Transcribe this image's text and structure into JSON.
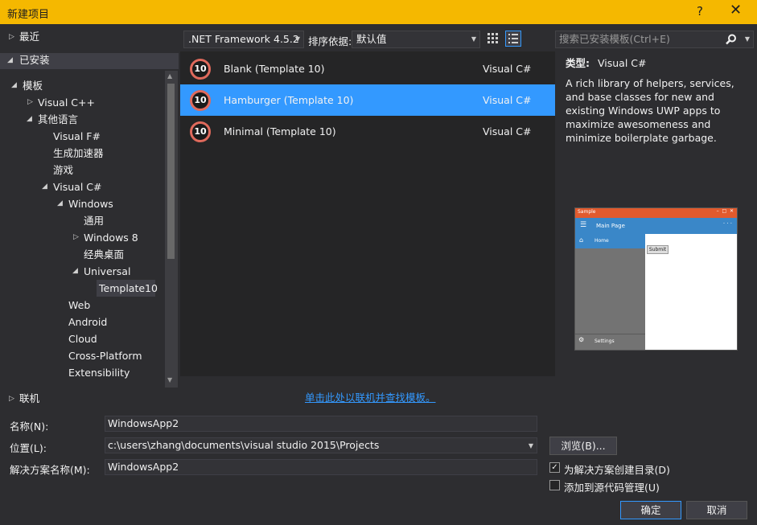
{
  "title": "新建项目",
  "title_help": "?",
  "title_close": "✕",
  "tree": {
    "recent": "最近",
    "installed": "已安装",
    "templates": "模板",
    "visual_cpp": "Visual C++",
    "other_languages": "其他语言",
    "visual_fsharp": "Visual F#",
    "generator": "生成加速器",
    "games": "游戏",
    "visual_csharp": "Visual C#",
    "windows": "Windows",
    "general": "通用",
    "windows8": "Windows 8",
    "classic_desktop": "经典桌面",
    "universal": "Universal",
    "template10": "Template10",
    "web": "Web",
    "android": "Android",
    "cloud": "Cloud",
    "cross_platform": "Cross-Platform",
    "extensibility": "Extensibility",
    "online": "联机"
  },
  "toolbar": {
    "framework": ".NET Framework 4.5.2",
    "sort_label": "排序依据:",
    "sort_value": "默认值"
  },
  "search": {
    "placeholder": "搜索已安装模板(Ctrl+E)"
  },
  "templates": [
    {
      "badge": "10",
      "name": "Blank (Template 10)",
      "lang": "Visual C#"
    },
    {
      "badge": "10",
      "name": "Hamburger (Template 10)",
      "lang": "Visual C#"
    },
    {
      "badge": "10",
      "name": "Minimal (Template 10)",
      "lang": "Visual C#"
    }
  ],
  "online_link": "单击此处以联机并查找模板。",
  "details": {
    "type_label": "类型:",
    "type_value": "Visual C#",
    "description": "A rich library of helpers, services, and base classes for new and existing Windows UWP apps to maximize awesomeness and minimize boilerplate garbage."
  },
  "preview": {
    "app_title": "Sample",
    "page_title": "Main Page",
    "nav_home": "Home",
    "nav_settings": "Settings",
    "button": "Submit"
  },
  "form": {
    "name_label": "名称(N):",
    "name_value": "WindowsApp2",
    "location_label": "位置(L):",
    "location_value": "c:\\users\\zhang\\documents\\visual studio 2015\\Projects",
    "solution_label": "解决方案名称(M):",
    "solution_value": "WindowsApp2",
    "browse": "浏览(B)...",
    "create_dir": "为解决方案创建目录(D)",
    "add_source_control": "添加到源代码管理(U)",
    "ok": "确定",
    "cancel": "取消"
  },
  "colors": {
    "title_bar": "#f5b800",
    "selection": "#3399ff",
    "badge_ring": "#e06a5c"
  }
}
